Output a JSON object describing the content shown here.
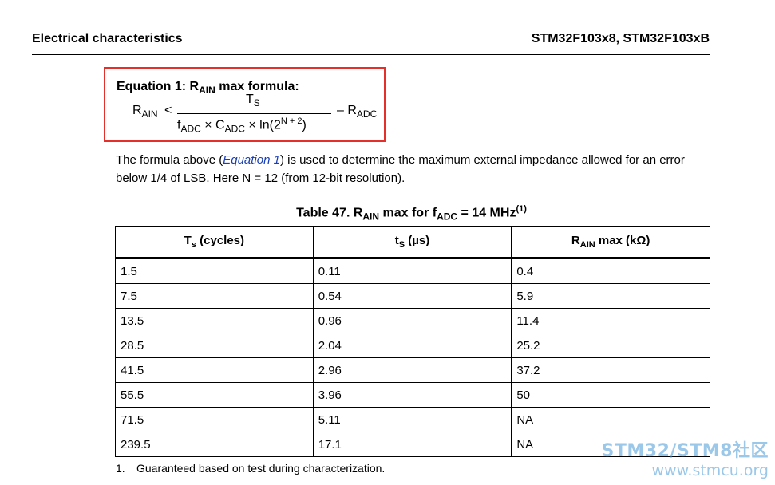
{
  "header": {
    "left": "Electrical characteristics",
    "right": "STM32F103x8, STM32F103xB"
  },
  "equation": {
    "title_prefix": "Equation 1: R",
    "title_sub": "AIN",
    "title_suffix": " max formula:",
    "lhs_main": "R",
    "lhs_sub": "AIN",
    "relation": "<",
    "num_main": "T",
    "num_sub": "S",
    "den_f": "f",
    "den_f_sub": "ADC",
    "den_times1": " × C",
    "den_c_sub": "ADC",
    "den_times2": " × ln(2",
    "den_exp": "N + 2",
    "den_close": ")",
    "rhs_main": "– R",
    "rhs_sub": "ADC"
  },
  "paragraph": {
    "before": "The formula above (",
    "link": "Equation 1",
    "after": ") is used to determine the maximum external impedance allowed for an error below 1/4 of LSB. Here N = 12 (from 12-bit resolution)."
  },
  "table": {
    "caption_a": "Table 47. R",
    "caption_a_sub": "AIN",
    "caption_b": " max for f",
    "caption_b_sub": "ADC",
    "caption_c": " = 14 MHz",
    "caption_sup": "(1)",
    "headers": [
      {
        "main": "T",
        "sub": "s",
        "rest": " (cycles)"
      },
      {
        "main": "t",
        "sub": "S",
        "rest": " (µs)"
      },
      {
        "main": "R",
        "sub": "AIN",
        "rest": " max (kΩ)"
      }
    ],
    "rows": [
      [
        "1.5",
        "0.11",
        "0.4"
      ],
      [
        "7.5",
        "0.54",
        "5.9"
      ],
      [
        "13.5",
        "0.96",
        "11.4"
      ],
      [
        "28.5",
        "2.04",
        "25.2"
      ],
      [
        "41.5",
        "2.96",
        "37.2"
      ],
      [
        "55.5",
        "3.96",
        "50"
      ],
      [
        "71.5",
        "5.11",
        "NA"
      ],
      [
        "239.5",
        "17.1",
        "NA"
      ]
    ]
  },
  "footnote": {
    "num": "1.",
    "text": "Guaranteed based on test during characterization."
  },
  "watermark": {
    "top": "STM32/STM8社区",
    "bottom": "www.stmcu.org"
  }
}
